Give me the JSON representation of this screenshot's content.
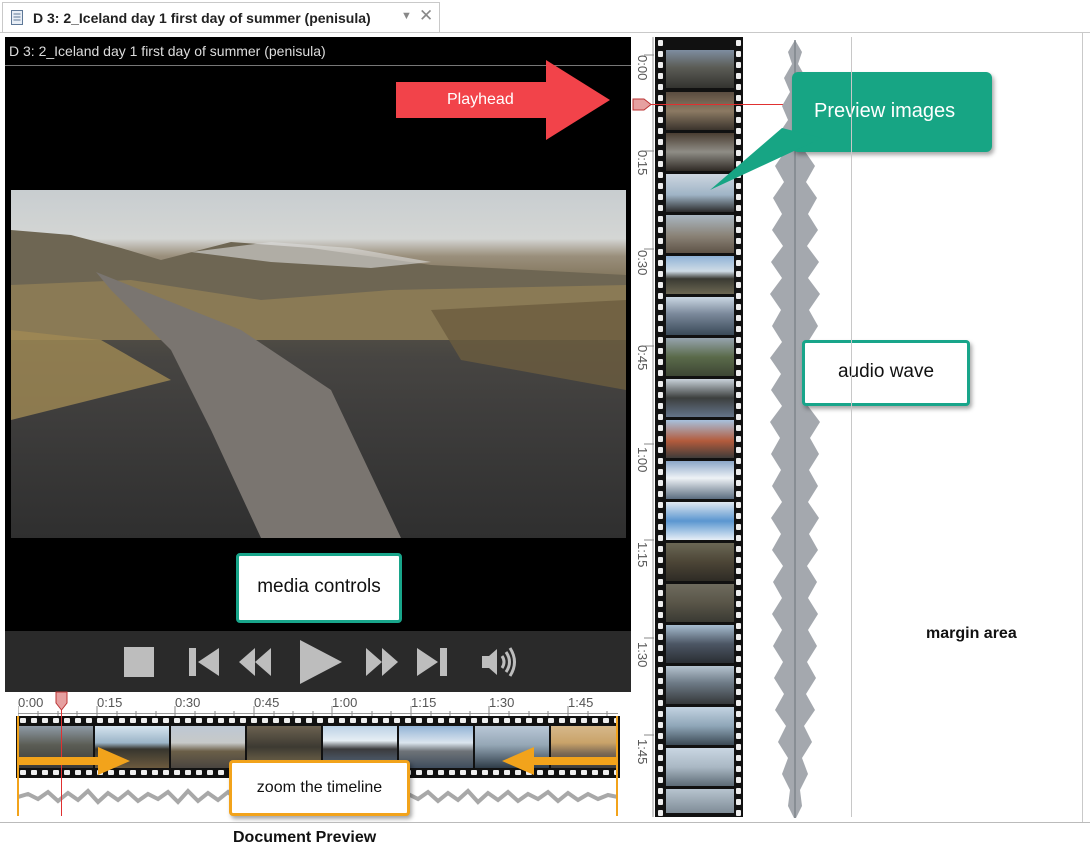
{
  "tab": {
    "title": "D 3: 2_Iceland day 1 first day of summer (penisula)",
    "dropdown_glyph": "▼",
    "close_glyph": "✕"
  },
  "video": {
    "title": "D 3: 2_Iceland day 1 first day of summer (penisula)"
  },
  "controls": [
    {
      "name": "stop-button",
      "icon": "stop-icon"
    },
    {
      "name": "skip-start-button",
      "icon": "skip-to-start-icon"
    },
    {
      "name": "rewind-button",
      "icon": "rewind-icon"
    },
    {
      "name": "play-button",
      "icon": "play-icon"
    },
    {
      "name": "fast-forward-button",
      "icon": "fast-forward-icon"
    },
    {
      "name": "skip-end-button",
      "icon": "skip-to-end-icon"
    },
    {
      "name": "volume-button",
      "icon": "volume-icon"
    }
  ],
  "timeline": {
    "ticks": [
      "0:00",
      "0:15",
      "0:30",
      "0:45",
      "1:00",
      "1:15",
      "1:30",
      "1:45"
    ]
  },
  "vertical_timeline": {
    "ticks": [
      "0:00",
      "0:15",
      "0:30",
      "0:45",
      "1:00",
      "1:15",
      "1:30",
      "1:45"
    ]
  },
  "callouts": {
    "playhead": "Playhead",
    "preview_images": "Preview images",
    "audio_wave": "audio wave",
    "media_controls": "media controls",
    "zoom": "zoom the timeline"
  },
  "labels": {
    "margin_area": "margin area",
    "document_preview": "Document Preview"
  },
  "colors": {
    "callout_border": "#18a58a",
    "preview_callout_bg": "#17a584",
    "playhead_arrow": "#f2434a",
    "zoom_arrows": "#f2a31b",
    "playhead_line": "#e03030"
  }
}
